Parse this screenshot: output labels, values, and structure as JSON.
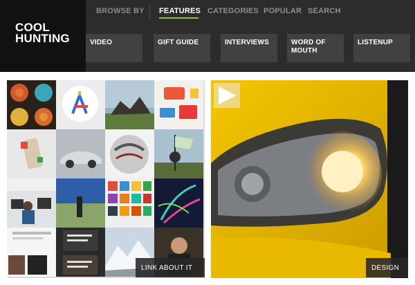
{
  "logo": {
    "line1": "COOL",
    "line2": "HUNTING"
  },
  "nav": {
    "browse_label": "BROWSE BY",
    "links": [
      "FEATURES",
      "CATEGORIES",
      "POPULAR",
      "SEARCH"
    ],
    "active": "FEATURES"
  },
  "subnav": [
    {
      "line1": "VIDEO",
      "line2": ""
    },
    {
      "line1": "GIFT GUIDE",
      "line2": ""
    },
    {
      "line1": "INTERVIEWS",
      "line2": ""
    },
    {
      "line1": "WORD OF",
      "line2": "MOUTH"
    },
    {
      "line1": "LISTENUP",
      "line2": ""
    }
  ],
  "mosaic": {
    "label": "LINK ABOUT IT"
  },
  "feature": {
    "label": "DESIGN",
    "play_icon": "play-icon"
  },
  "colors": {
    "accent": "#89c53f",
    "header_bg": "#2c2c2c",
    "logo_bg": "#111111",
    "button_bg": "#414141"
  }
}
